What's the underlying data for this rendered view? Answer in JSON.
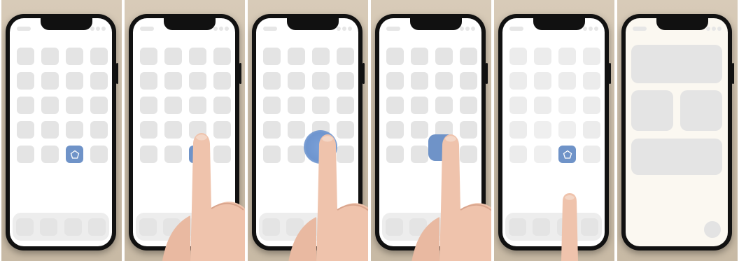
{
  "panels": [
    {
      "id": "step-1",
      "state": "home screen with highlighted app icon"
    },
    {
      "id": "step-2",
      "state": "finger touches app icon"
    },
    {
      "id": "step-3",
      "state": "long press shows expanding circle"
    },
    {
      "id": "step-4",
      "state": "icon lifts under finger"
    },
    {
      "id": "step-5",
      "state": "icon dragged upward, apps fade"
    },
    {
      "id": "step-6",
      "state": "widget layout screen"
    }
  ],
  "colors": {
    "accent_icon": "#6f93c8",
    "app_placeholder": "#e4e4e4",
    "background_wood": "#d8cbb8",
    "phone_frame": "#111111"
  },
  "icons": {
    "app_glyph": "pentagon-icon",
    "gesture": "finger-icon"
  }
}
